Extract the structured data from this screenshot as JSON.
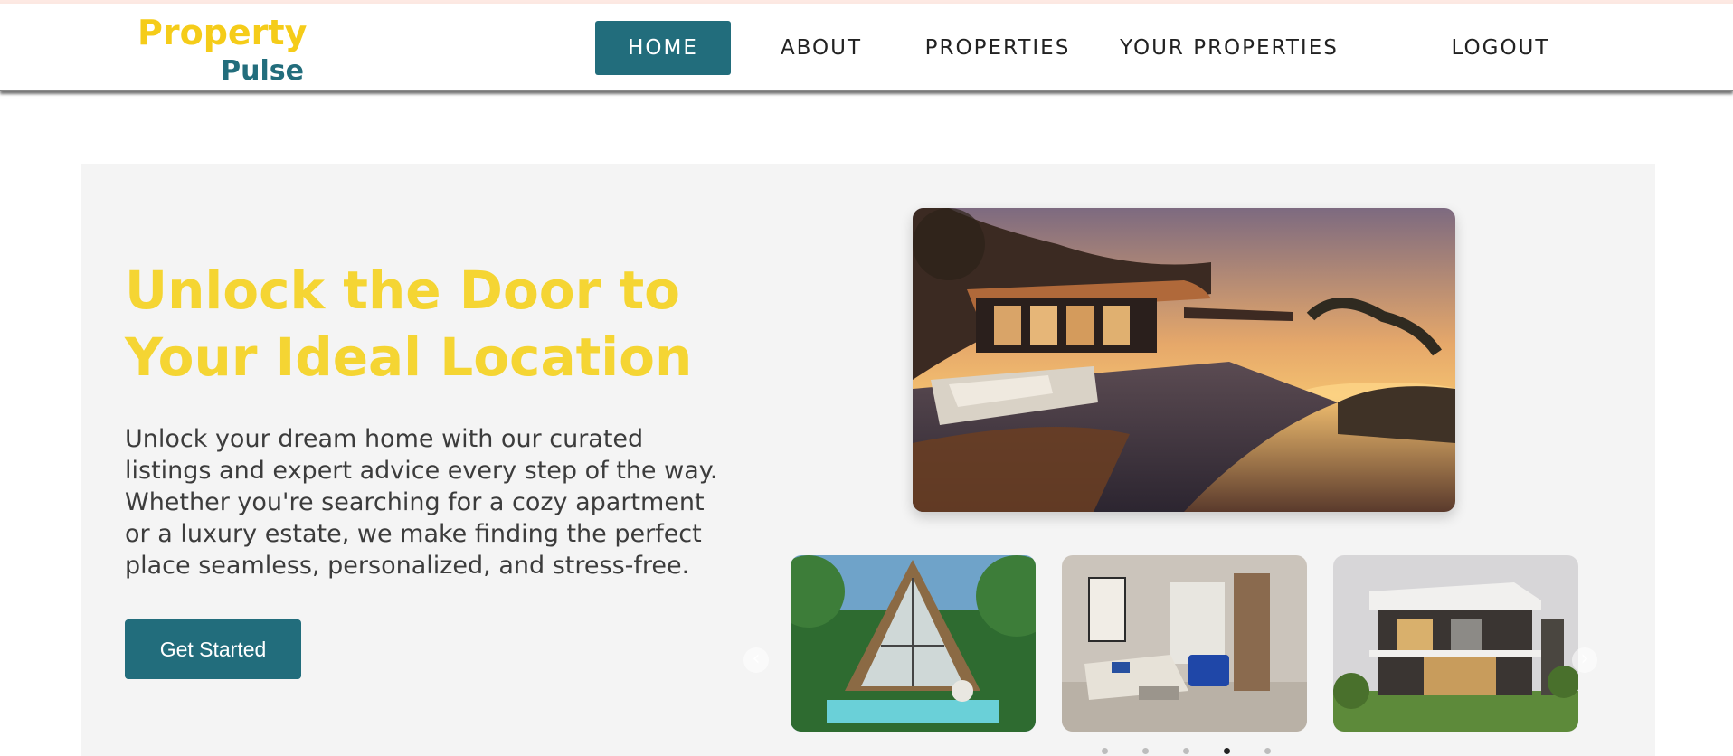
{
  "brand": {
    "line1": "Property",
    "line2": "Pulse",
    "yellow": "#f5cc19",
    "teal": "#226d7c"
  },
  "nav": {
    "items": [
      {
        "label": "HOME",
        "active": true
      },
      {
        "label": "ABOUT",
        "active": false
      },
      {
        "label": "PROPERTIES",
        "active": false
      },
      {
        "label": "YOUR PROPERTIES",
        "active": false
      },
      {
        "label": "LOGOUT",
        "active": false
      }
    ]
  },
  "hero": {
    "title_line1": "Unlock the Door to",
    "title_line2": "Your Ideal Location",
    "text_lines": [
      "Unlock your dream home with our curated",
      "listings and expert advice every step of the way.",
      "Whether you're searching for a cozy apartment",
      "or a luxury estate, we make finding the perfect",
      "place seamless, personalized, and stress-free."
    ],
    "cta_label": "Get Started"
  },
  "carousel": {
    "prev_icon": "chevron-left-icon",
    "next_icon": "chevron-right-icon",
    "active_dot": 4,
    "dot_count": 5
  }
}
